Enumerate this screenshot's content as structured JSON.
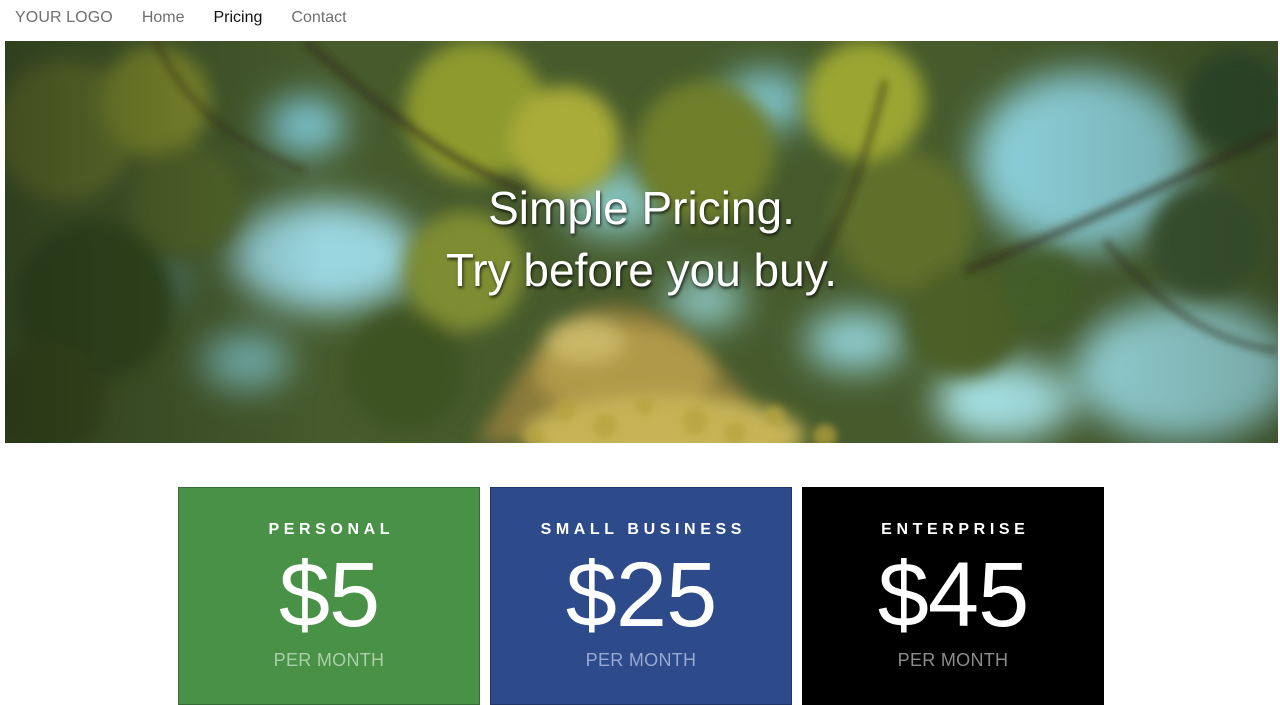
{
  "nav": {
    "logo": "YOUR LOGO",
    "links": [
      {
        "label": "Home",
        "active": false
      },
      {
        "label": "Pricing",
        "active": true
      },
      {
        "label": "Contact",
        "active": false
      }
    ]
  },
  "hero": {
    "line1": "Simple Pricing.",
    "line2": "Try before you buy.",
    "image": "forest-canopy-photo"
  },
  "pricing": {
    "plans": [
      {
        "name": "PERSONAL",
        "price": "$5",
        "period": "PER MONTH",
        "color": "#4a9148"
      },
      {
        "name": "SMALL BUSINESS",
        "price": "$25",
        "period": "PER MONTH",
        "color": "#2d4a8a"
      },
      {
        "name": "ENTERPRISE",
        "price": "$45",
        "period": "PER MONTH",
        "color": "#000000"
      }
    ]
  },
  "colors": {
    "nav_text": "#6f6f6f",
    "nav_active": "#111111",
    "hero_text": "#ffffff"
  }
}
